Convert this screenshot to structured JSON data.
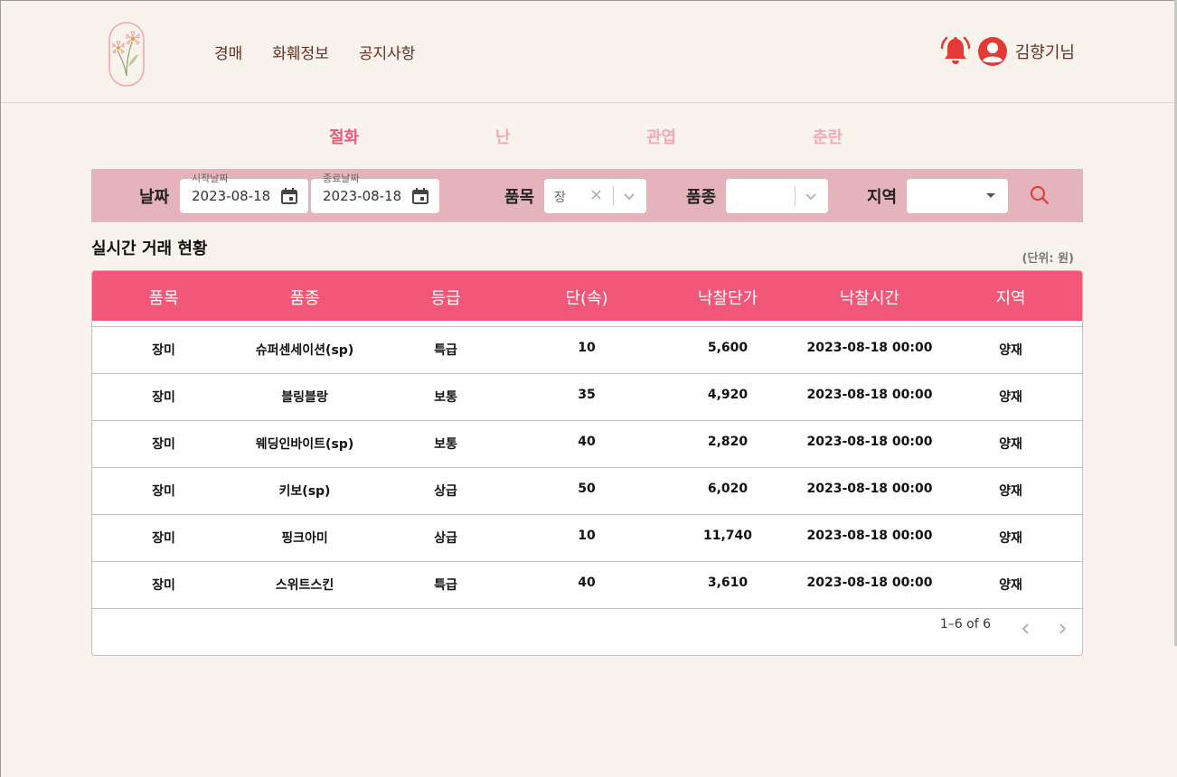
{
  "header": {
    "nav": [
      "경매",
      "화훼정보",
      "공지사항"
    ],
    "username": "김향기님"
  },
  "tabs": [
    "절화",
    "난",
    "관엽",
    "춘란"
  ],
  "active_tab": "절화",
  "filter": {
    "date_label": "날짜",
    "start_legend": "시작날짜",
    "start_value": "2023-08-18",
    "end_legend": "종료날짜",
    "end_value": "2023-08-18",
    "item_label": "품목",
    "item_value": "장",
    "variety_label": "품종",
    "variety_value": "",
    "region_label": "지역",
    "region_value": ""
  },
  "section": {
    "title": "실시간 거래 현황",
    "unit": "(단위: 원)"
  },
  "table": {
    "headers": [
      "품목",
      "품종",
      "등급",
      "단(속)",
      "낙찰단가",
      "낙찰시간",
      "지역"
    ],
    "rows": [
      [
        "장미",
        "슈퍼센세이션(sp)",
        "특급",
        "10",
        "5,600",
        "2023-08-18 00:00",
        "양재"
      ],
      [
        "장미",
        "블링블랑",
        "보통",
        "35",
        "4,920",
        "2023-08-18 00:00",
        "양재"
      ],
      [
        "장미",
        "웨딩인바이트(sp)",
        "보통",
        "40",
        "2,820",
        "2023-08-18 00:00",
        "양재"
      ],
      [
        "장미",
        "키보(sp)",
        "상급",
        "50",
        "6,020",
        "2023-08-18 00:00",
        "양재"
      ],
      [
        "장미",
        "핑크아미",
        "상급",
        "10",
        "11,740",
        "2023-08-18 00:00",
        "양재"
      ],
      [
        "장미",
        "스위트스킨",
        "특급",
        "40",
        "3,610",
        "2023-08-18 00:00",
        "양재"
      ]
    ]
  },
  "pagination": {
    "info": "1–6 of 6"
  },
  "colors": {
    "accent": "#f2577a",
    "filter_bg": "#e4b3bb",
    "page_bg": "#f8f3ec",
    "nav_text": "#6a2c20",
    "icon_red": "#e53935"
  },
  "icons": [
    "logo-flower-icon",
    "bell-icon",
    "user-avatar-icon",
    "calendar-icon",
    "close-icon",
    "chevron-down-icon",
    "search-icon",
    "chevron-left-icon",
    "chevron-right-icon"
  ]
}
